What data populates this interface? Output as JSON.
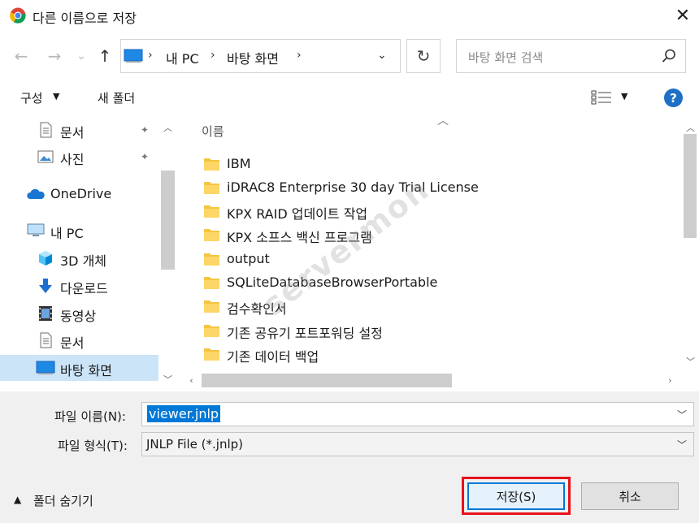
{
  "window": {
    "title": "다른 이름으로 저장",
    "close_glyph": "✕"
  },
  "nav": {
    "back_glyph": "←",
    "forward_glyph": "→",
    "recent_glyph": "⌄",
    "up_glyph": "↑",
    "breadcrumb": [
      "내 PC",
      "바탕 화면"
    ],
    "separator": "›",
    "refresh_glyph": "↻",
    "search_placeholder": "바탕 화면 검색"
  },
  "toolbar": {
    "organize_label": "구성",
    "new_folder_label": "새 폴더",
    "help_label": "?"
  },
  "sidebar": {
    "items": [
      {
        "label": "문서",
        "icon": "document-icon",
        "pinned": true
      },
      {
        "label": "사진",
        "icon": "pictures-icon",
        "pinned": true
      },
      {
        "label": "OneDrive",
        "icon": "cloud-icon",
        "pinned": false
      },
      {
        "label": "내 PC",
        "icon": "computer-icon",
        "pinned": false
      },
      {
        "label": "3D 개체",
        "icon": "cube-icon",
        "pinned": false
      },
      {
        "label": "다운로드",
        "icon": "download-icon",
        "pinned": false
      },
      {
        "label": "동영상",
        "icon": "video-icon",
        "pinned": false
      },
      {
        "label": "문서",
        "icon": "document-icon",
        "pinned": false
      },
      {
        "label": "바탕 화면",
        "icon": "desktop-icon",
        "pinned": false,
        "selected": true
      }
    ],
    "pin_glyph": "📌"
  },
  "files": {
    "column_name": "이름",
    "items": [
      "IBM",
      "iDRAC8 Enterprise 30 day Trial License",
      "KPX RAID 업데이트 작업",
      "KPX 소프스 백신 프로그램",
      "output",
      "SQLiteDatabaseBrowserPortable",
      "검수확인서",
      "기존 공유기 포트포워딩 설정",
      "기존 데이터 백업"
    ]
  },
  "form": {
    "filename_label": "파일 이름(N):",
    "filename_value": "viewer.jnlp",
    "filetype_label": "파일 형식(T):",
    "filetype_value": "JNLP File (*.jnlp)"
  },
  "footer": {
    "hide_folders_label": "폴더 숨기기",
    "save_label": "저장(S)",
    "cancel_label": "취소"
  },
  "watermark": "servermon",
  "colors": {
    "accent": "#0078d7",
    "selection": "#cce4f7",
    "highlight_box": "#e8121c",
    "folder": "#f4c542",
    "help": "#1f6fc5"
  }
}
